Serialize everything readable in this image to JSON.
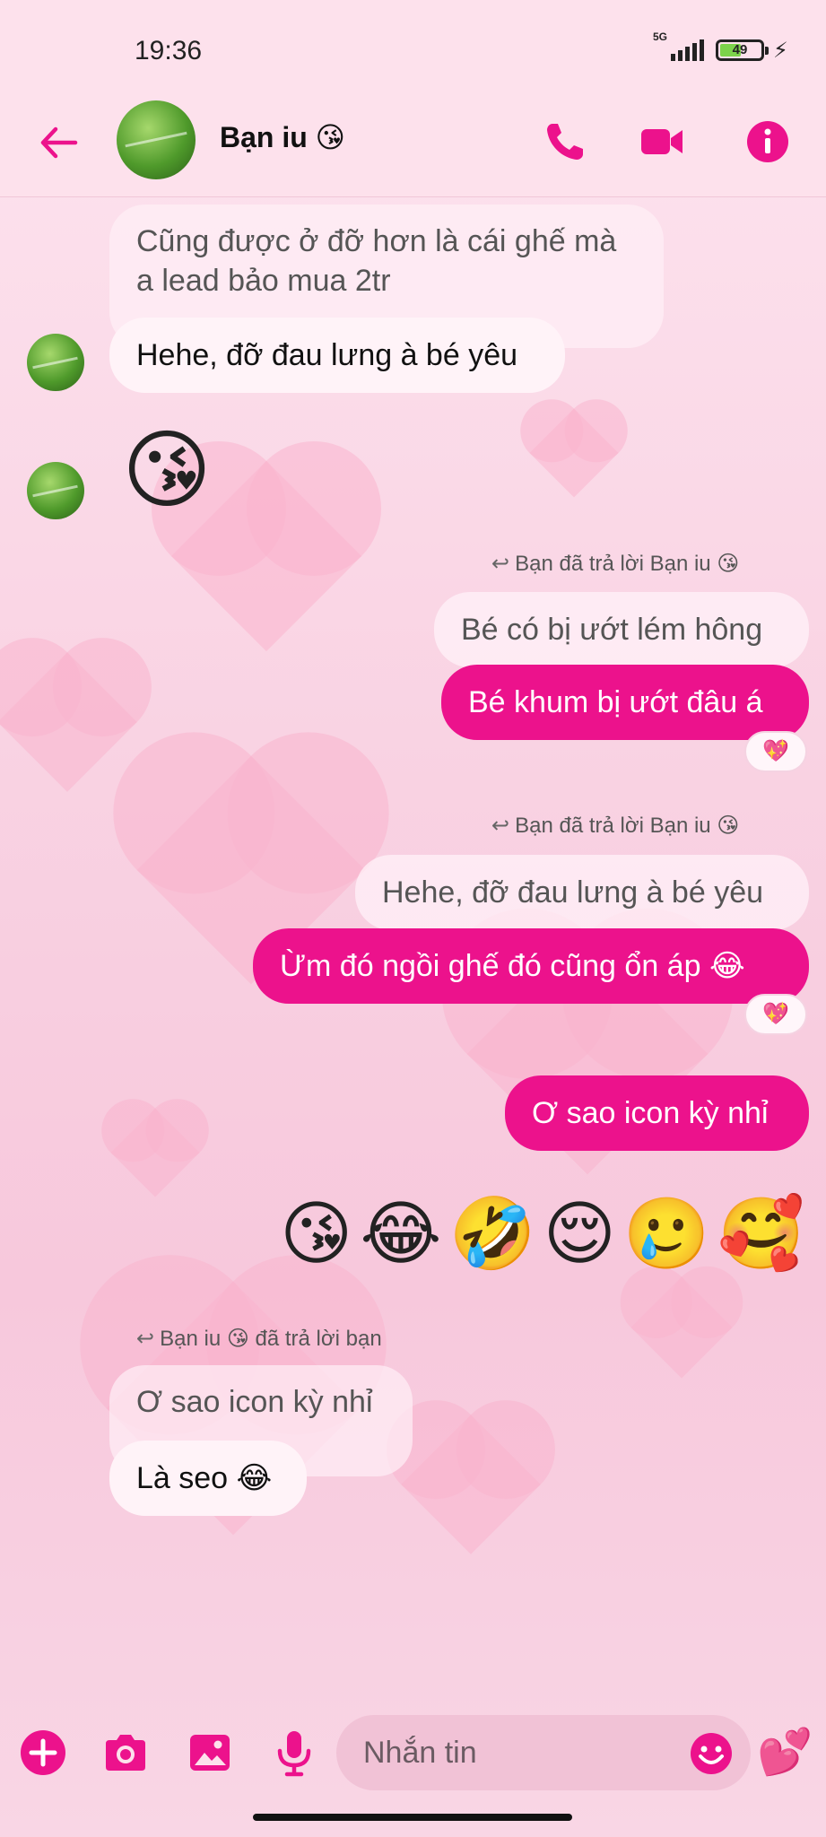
{
  "status_bar": {
    "time": "19:36",
    "network": "5G",
    "battery_level": "49",
    "battery_fraction": 0.49
  },
  "header": {
    "contact_name": "Bạn iu 😘",
    "icons": [
      "back-arrow-icon",
      "phone-icon",
      "video-camera-icon",
      "info-icon"
    ],
    "accent_color": "#ec128c"
  },
  "messages": [
    {
      "from": "contact",
      "quoted": true,
      "text": "Cũng được ở đỡ hơn là cái ghế mà a lead bảo mua 2tr"
    },
    {
      "from": "contact",
      "text": "Hehe, đỡ đau lưng à bé yêu"
    },
    {
      "from": "contact",
      "emoji": "😘"
    },
    {
      "from": "me",
      "reply_note": "Bạn đã trả lời Bạn iu 😘",
      "quoted": "Bé có bị ướt lém hông",
      "text": "Bé khum bị ướt đâu á",
      "reaction": "💖"
    },
    {
      "from": "me",
      "reply_note": "Bạn đã trả lời Bạn iu 😘",
      "quoted": "Hehe, đỡ đau lưng à bé yêu",
      "text": "Ừm đó ngồi ghế đó cũng ổn áp 😂",
      "reaction": "💖"
    },
    {
      "from": "me",
      "text": "Ơ sao icon kỳ nhỉ"
    },
    {
      "from": "me",
      "emojis": "😘😂🤣😌🥲🥰"
    },
    {
      "from": "contact",
      "reply_note": "Bạn iu 😘 đã trả lời bạn",
      "quoted": "Ơ sao icon kỳ nhỉ",
      "text": "Là seo 😂"
    }
  ],
  "composer": {
    "placeholder": "Nhắn tin",
    "icons": [
      "add-icon",
      "camera-icon",
      "gallery-icon",
      "microphone-icon",
      "emoji-icon"
    ],
    "send_emoji": "💕"
  }
}
